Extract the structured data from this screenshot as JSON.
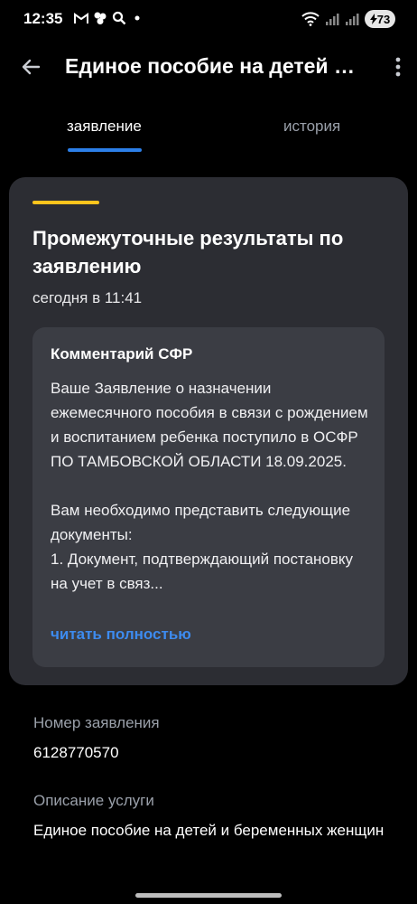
{
  "status_bar": {
    "time": "12:35",
    "battery": "73",
    "icons": [
      "gmail-icon",
      "app-icon",
      "search-icon",
      "dot-icon",
      "wifi-icon",
      "signal-icon",
      "signal-icon",
      "charging-icon"
    ]
  },
  "app_bar": {
    "title": "Единое пособие на детей и беременных женщин"
  },
  "tabs": [
    {
      "label": "заявление",
      "active": true
    },
    {
      "label": "история",
      "active": false
    }
  ],
  "card": {
    "title": "Промежуточные результаты по заявлению",
    "date": "сегодня в 11:41",
    "accent_color": "#ffc41d",
    "comment": {
      "title": "Комментарий СФР",
      "text": "Ваше Заявление о назначении ежемесячного пособия в связи с рождением и воспитанием ребенка поступило в ОСФР ПО ТАМБОВСКОЙ ОБЛАСТИ 18.09.2025.\n\nВам необходимо представить следующие документы:\n1. Документ, подтверждающий постановку на учет в связ...",
      "read_more": "читать полностью"
    }
  },
  "info": [
    {
      "label": "Номер заявления",
      "value": "6128770570"
    },
    {
      "label": "Описание услуги",
      "value": "Единое пособие на детей и беременных женщин"
    }
  ],
  "colors": {
    "accent_blue": "#2c7fe8",
    "link_blue": "#3d8bef",
    "card_bg": "#2c2d33"
  }
}
